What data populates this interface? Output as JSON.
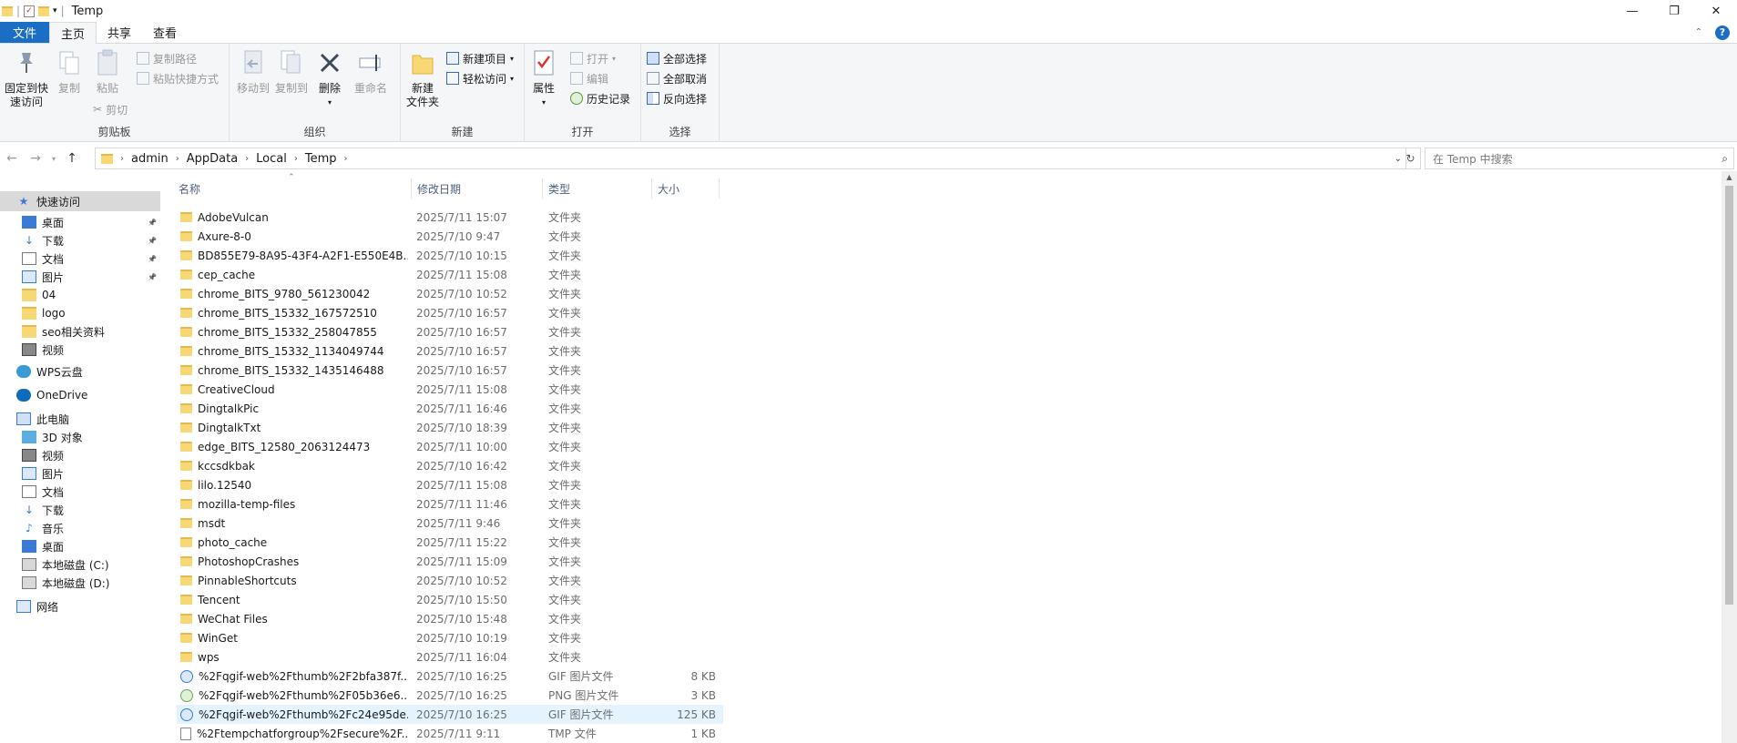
{
  "window": {
    "title": "Temp",
    "controls": [
      "—",
      "❐",
      "✕"
    ]
  },
  "ribbon_tabs": [
    "文件",
    "主页",
    "共享",
    "查看"
  ],
  "ribbon": {
    "clipboard": {
      "pin_label": "固定到快\n速访问",
      "copy": "复制",
      "paste": "粘贴",
      "copy_path": "复制路径",
      "paste_shortcut": "粘贴快捷方式",
      "cut": "剪切",
      "group": "剪贴板"
    },
    "organize": {
      "move_to": "移动到",
      "copy_to": "复制到",
      "delete": "删除",
      "rename": "重命名",
      "group": "组织"
    },
    "new": {
      "new_folder": "新建\n文件夹",
      "new_item": "新建项目",
      "easy_access": "轻松访问",
      "group": "新建"
    },
    "open": {
      "properties": "属性",
      "open": "打开",
      "edit": "编辑",
      "history": "历史记录",
      "group": "打开"
    },
    "select": {
      "select_all": "全部选择",
      "select_none": "全部取消",
      "invert": "反向选择",
      "group": "选择"
    }
  },
  "address": {
    "crumbs": [
      "admin",
      "AppData",
      "Local",
      "Temp"
    ]
  },
  "search": {
    "placeholder": "在 Temp 中搜索"
  },
  "sidebar": {
    "items": [
      {
        "label": "快速访问",
        "icon": "star-icon",
        "pinned": false
      },
      {
        "label": "桌面",
        "icon": "desktop-icon",
        "pinned": true
      },
      {
        "label": "下载",
        "icon": "download-icon",
        "pinned": true
      },
      {
        "label": "文档",
        "icon": "document-icon",
        "pinned": true
      },
      {
        "label": "图片",
        "icon": "picture-icon",
        "pinned": true
      },
      {
        "label": "04",
        "icon": "folder-icon",
        "pinned": false
      },
      {
        "label": "logo",
        "icon": "folder-icon",
        "pinned": false
      },
      {
        "label": "seo相关资料",
        "icon": "folder-icon",
        "pinned": false
      },
      {
        "label": "视频",
        "icon": "video-icon",
        "pinned": false
      },
      {
        "label": "WPS云盘",
        "icon": "cloud-icon",
        "pinned": false
      },
      {
        "label": "OneDrive",
        "icon": "onedrive-icon",
        "pinned": false
      },
      {
        "label": "此电脑",
        "icon": "computer-icon",
        "pinned": false
      },
      {
        "label": "3D 对象",
        "icon": "3d-icon",
        "pinned": false
      },
      {
        "label": "视频",
        "icon": "video-icon",
        "pinned": false
      },
      {
        "label": "图片",
        "icon": "picture-icon",
        "pinned": false
      },
      {
        "label": "文档",
        "icon": "document-icon",
        "pinned": false
      },
      {
        "label": "下载",
        "icon": "download-icon",
        "pinned": false
      },
      {
        "label": "音乐",
        "icon": "music-icon",
        "pinned": false
      },
      {
        "label": "桌面",
        "icon": "desktop-icon",
        "pinned": false
      },
      {
        "label": "本地磁盘 (C:)",
        "icon": "drive-icon",
        "pinned": false
      },
      {
        "label": "本地磁盘 (D:)",
        "icon": "drive-icon",
        "pinned": false
      },
      {
        "label": "网络",
        "icon": "network-icon",
        "pinned": false
      }
    ]
  },
  "columns": [
    "名称",
    "修改日期",
    "类型",
    "大小"
  ],
  "files": [
    {
      "name": "AdobeVulcan",
      "date": "2025/7/11 15:07",
      "type": "文件夹",
      "size": "",
      "kind": "folder"
    },
    {
      "name": "Axure-8-0",
      "date": "2025/7/10 9:47",
      "type": "文件夹",
      "size": "",
      "kind": "folder"
    },
    {
      "name": "BD855E79-8A95-43F4-A2F1-E550E4B...",
      "date": "2025/7/10 10:15",
      "type": "文件夹",
      "size": "",
      "kind": "folder"
    },
    {
      "name": "cep_cache",
      "date": "2025/7/11 15:08",
      "type": "文件夹",
      "size": "",
      "kind": "folder"
    },
    {
      "name": "chrome_BITS_9780_561230042",
      "date": "2025/7/10 10:52",
      "type": "文件夹",
      "size": "",
      "kind": "folder"
    },
    {
      "name": "chrome_BITS_15332_167572510",
      "date": "2025/7/10 16:57",
      "type": "文件夹",
      "size": "",
      "kind": "folder"
    },
    {
      "name": "chrome_BITS_15332_258047855",
      "date": "2025/7/10 16:57",
      "type": "文件夹",
      "size": "",
      "kind": "folder"
    },
    {
      "name": "chrome_BITS_15332_1134049744",
      "date": "2025/7/10 16:57",
      "type": "文件夹",
      "size": "",
      "kind": "folder"
    },
    {
      "name": "chrome_BITS_15332_1435146488",
      "date": "2025/7/10 16:57",
      "type": "文件夹",
      "size": "",
      "kind": "folder"
    },
    {
      "name": "CreativeCloud",
      "date": "2025/7/11 15:08",
      "type": "文件夹",
      "size": "",
      "kind": "folder"
    },
    {
      "name": "DingtalkPic",
      "date": "2025/7/11 16:46",
      "type": "文件夹",
      "size": "",
      "kind": "folder"
    },
    {
      "name": "DingtalkTxt",
      "date": "2025/7/10 18:39",
      "type": "文件夹",
      "size": "",
      "kind": "folder"
    },
    {
      "name": "edge_BITS_12580_2063124473",
      "date": "2025/7/11 10:00",
      "type": "文件夹",
      "size": "",
      "kind": "folder"
    },
    {
      "name": "kccsdkbak",
      "date": "2025/7/10 16:42",
      "type": "文件夹",
      "size": "",
      "kind": "folder"
    },
    {
      "name": "lilo.12540",
      "date": "2025/7/11 15:08",
      "type": "文件夹",
      "size": "",
      "kind": "folder"
    },
    {
      "name": "mozilla-temp-files",
      "date": "2025/7/11 11:46",
      "type": "文件夹",
      "size": "",
      "kind": "folder"
    },
    {
      "name": "msdt",
      "date": "2025/7/11 9:46",
      "type": "文件夹",
      "size": "",
      "kind": "folder"
    },
    {
      "name": "photo_cache",
      "date": "2025/7/11 15:22",
      "type": "文件夹",
      "size": "",
      "kind": "folder"
    },
    {
      "name": "PhotoshopCrashes",
      "date": "2025/7/11 15:09",
      "type": "文件夹",
      "size": "",
      "kind": "folder"
    },
    {
      "name": "PinnableShortcuts",
      "date": "2025/7/10 10:52",
      "type": "文件夹",
      "size": "",
      "kind": "folder"
    },
    {
      "name": "Tencent",
      "date": "2025/7/10 15:50",
      "type": "文件夹",
      "size": "",
      "kind": "folder"
    },
    {
      "name": "WeChat Files",
      "date": "2025/7/10 15:48",
      "type": "文件夹",
      "size": "",
      "kind": "folder"
    },
    {
      "name": "WinGet",
      "date": "2025/7/10 10:19",
      "type": "文件夹",
      "size": "",
      "kind": "folder"
    },
    {
      "name": "wps",
      "date": "2025/7/11 16:04",
      "type": "文件夹",
      "size": "",
      "kind": "folder"
    },
    {
      "name": "%2Fqgif-web%2Fthumb%2F2bfa387f...",
      "date": "2025/7/10 16:25",
      "type": "GIF 图片文件",
      "size": "8 KB",
      "kind": "gif"
    },
    {
      "name": "%2Fqgif-web%2Fthumb%2F05b36e6...",
      "date": "2025/7/10 16:25",
      "type": "PNG 图片文件",
      "size": "3 KB",
      "kind": "png"
    },
    {
      "name": "%2Fqgif-web%2Fthumb%2Fc24e95de...",
      "date": "2025/7/10 16:25",
      "type": "GIF 图片文件",
      "size": "125 KB",
      "kind": "gif"
    },
    {
      "name": "%2Ftempchatforgroup%2Fsecure%2F...",
      "date": "2025/7/11 9:11",
      "type": "TMP 文件",
      "size": "1 KB",
      "kind": "tmp"
    }
  ],
  "selected_file_index": 26,
  "colors": {
    "accent": "#1a6ec3",
    "folder": "#f8d775",
    "selection": "#e5f3ff"
  }
}
